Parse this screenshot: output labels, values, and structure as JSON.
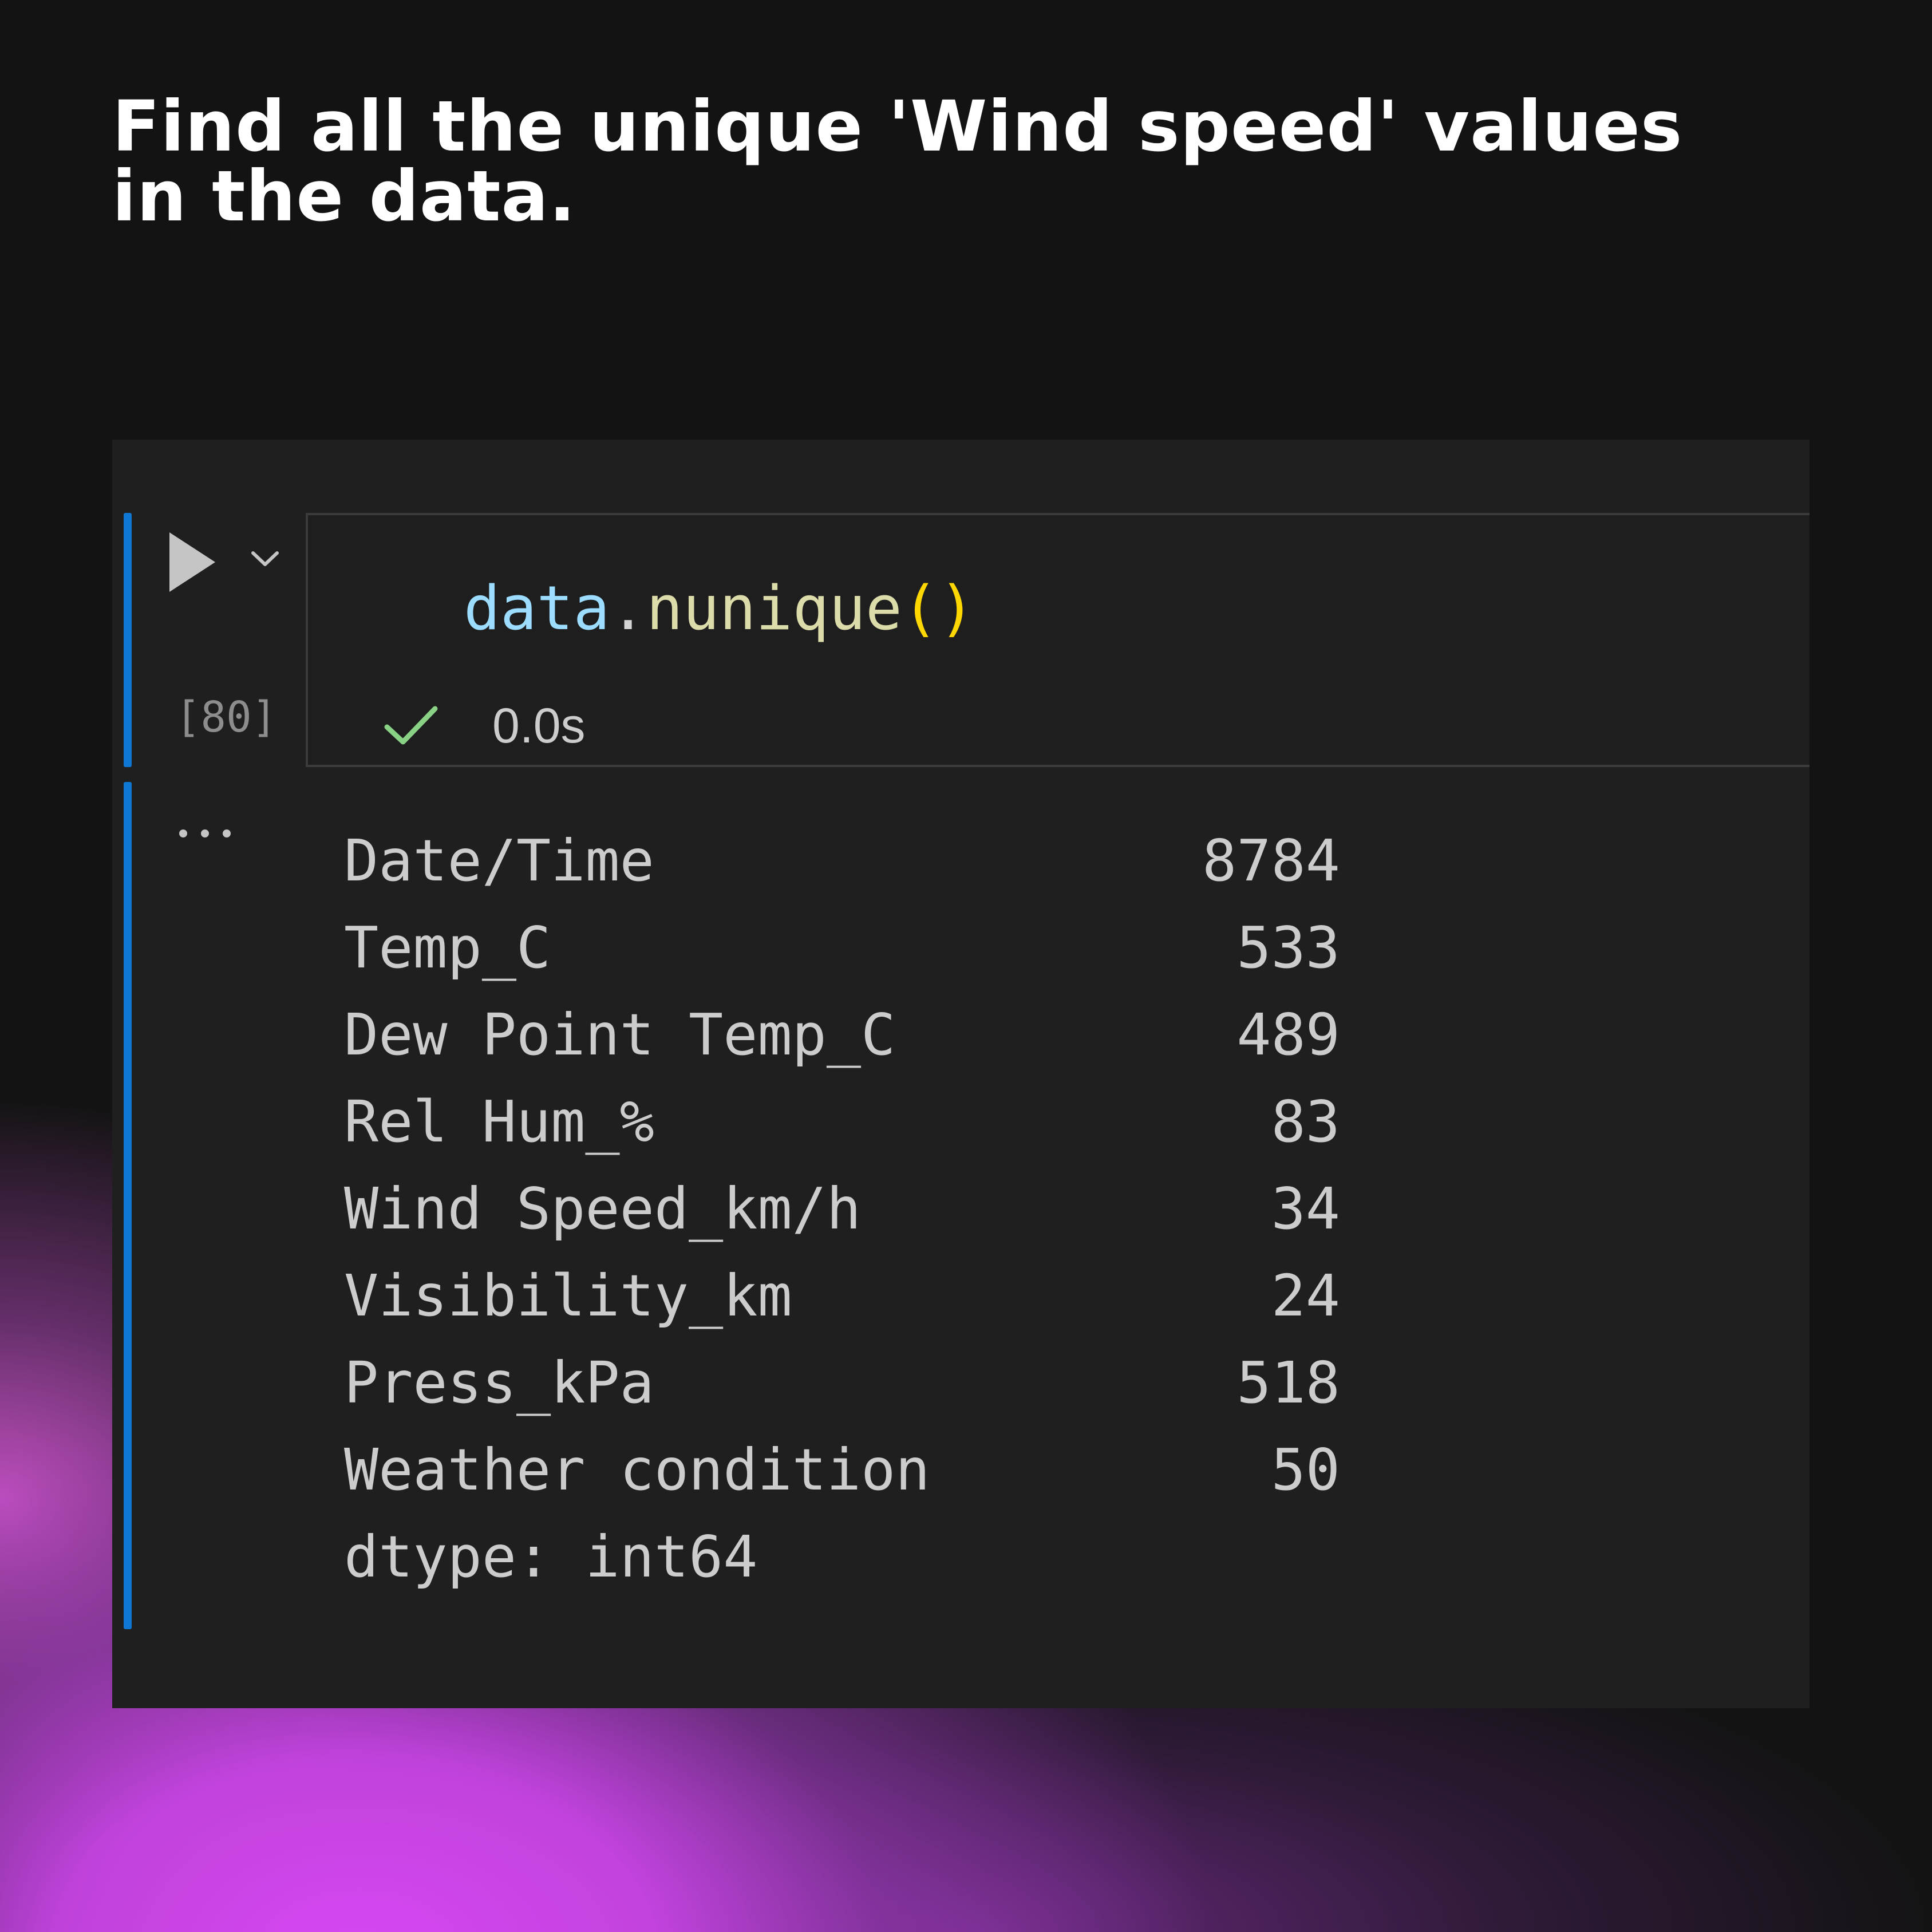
{
  "headline": {
    "line1": "Find all the unique 'Wind speed' values",
    "line2": "in the data."
  },
  "cell": {
    "execution_count": "[80]",
    "code": {
      "object": "data",
      "dot": ".",
      "method": "nunique",
      "parens": "()"
    },
    "status": {
      "icon": "check-icon",
      "duration": "0.0s",
      "color": "#89d185"
    },
    "run_icon": "play-icon",
    "menu_icon": "chevron-down-icon",
    "output_menu_icon": "ellipsis-icon"
  },
  "output": {
    "rows": [
      {
        "name": "Date/Time",
        "value": "8784"
      },
      {
        "name": "Temp_C",
        "value": "533"
      },
      {
        "name": "Dew Point Temp_C",
        "value": "489"
      },
      {
        "name": "Rel Hum_%",
        "value": "83"
      },
      {
        "name": "Wind Speed_km/h",
        "value": "34"
      },
      {
        "name": "Visibility_km",
        "value": "24"
      },
      {
        "name": "Press_kPa",
        "value": "518"
      },
      {
        "name": "Weather condition",
        "value": "50"
      }
    ],
    "dtype_line": "dtype: int64"
  },
  "colors": {
    "background": "#131313",
    "panel": "#1f1f1f",
    "cell_bar": "#0e78d4",
    "accent_glow": "#d548f0"
  }
}
